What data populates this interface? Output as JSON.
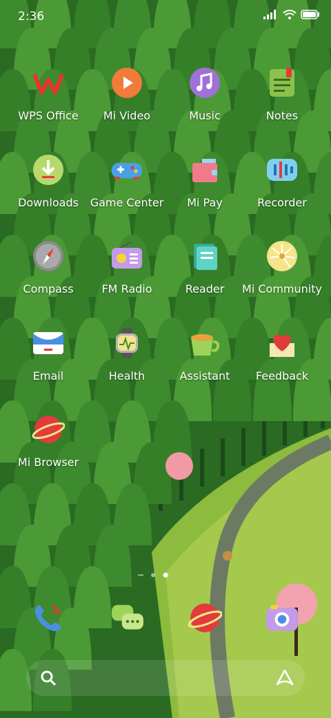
{
  "status_bar": {
    "time": "2:36"
  },
  "apps": [
    {
      "label": "WPS Office",
      "icon": "wps-office-icon"
    },
    {
      "label": "Mi Video",
      "icon": "play-icon"
    },
    {
      "label": "Music",
      "icon": "music-note-icon"
    },
    {
      "label": "Notes",
      "icon": "notes-icon"
    },
    {
      "label": "Downloads",
      "icon": "download-icon"
    },
    {
      "label": "Game Center",
      "icon": "gamepad-icon"
    },
    {
      "label": "Mi Pay",
      "icon": "wallet-icon"
    },
    {
      "label": "Recorder",
      "icon": "recorder-icon"
    },
    {
      "label": "Compass",
      "icon": "compass-icon"
    },
    {
      "label": "FM Radio",
      "icon": "radio-icon"
    },
    {
      "label": "Reader",
      "icon": "book-icon"
    },
    {
      "label": "Mi Community",
      "icon": "dandelion-icon"
    },
    {
      "label": "Email",
      "icon": "envelope-icon"
    },
    {
      "label": "Health",
      "icon": "health-watch-icon"
    },
    {
      "label": "Assistant",
      "icon": "cup-icon"
    },
    {
      "label": "Feedback",
      "icon": "heart-box-icon"
    },
    {
      "label": "Mi Browser",
      "icon": "planet-icon"
    }
  ],
  "dock": [
    "phone-icon",
    "messages-icon",
    "browser-planet-icon",
    "camera-icon"
  ],
  "pager": {
    "pages": 3,
    "current": 3
  }
}
